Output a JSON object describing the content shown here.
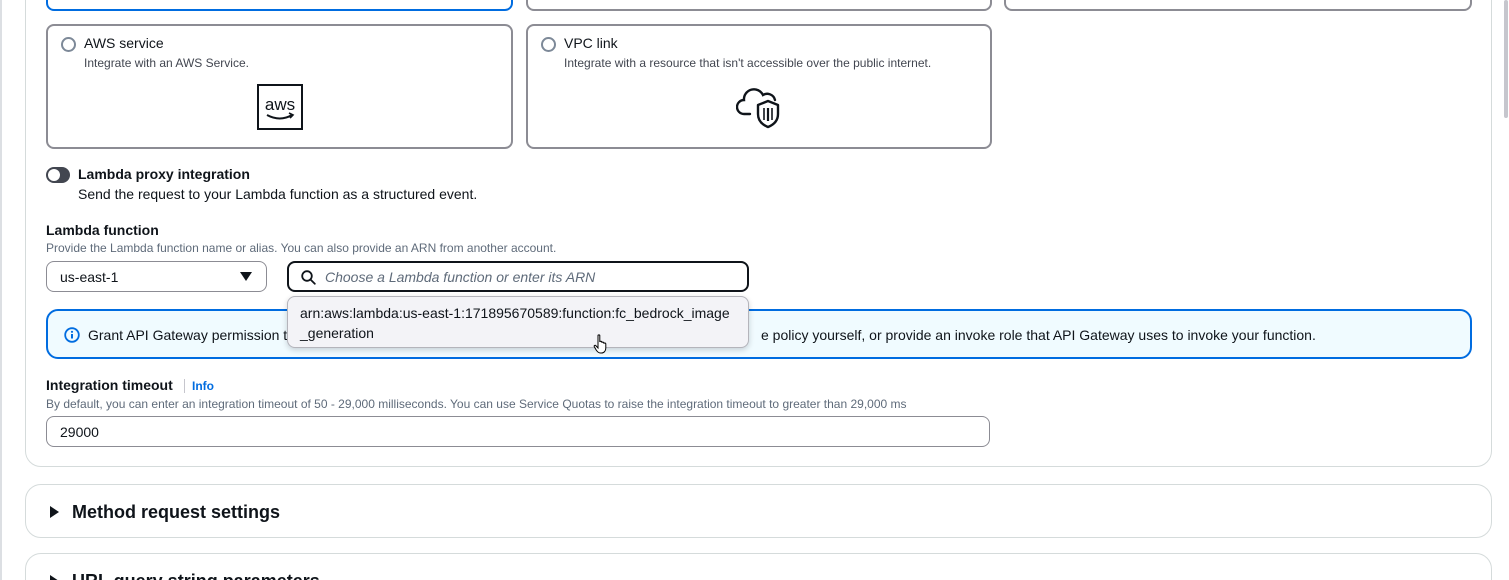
{
  "integration_types": {
    "aws_service": {
      "title": "AWS service",
      "description": "Integrate with an AWS Service.",
      "icon": "aws-logo-icon"
    },
    "vpc_link": {
      "title": "VPC link",
      "description": "Integrate with a resource that isn't accessible over the public internet.",
      "icon": "cloud-shield-icon"
    }
  },
  "proxy": {
    "label": "Lambda proxy integration",
    "description": "Send the request to your Lambda function as a structured event.",
    "enabled": false
  },
  "lambda_function": {
    "label": "Lambda function",
    "description": "Provide the Lambda function name or alias. You can also provide an ARN from another account.",
    "region": "us-east-1",
    "search_placeholder": "Choose a Lambda function or enter its ARN",
    "dropdown_option": "arn:aws:lambda:us-east-1:171895670589:function:fc_bedrock_image_generation"
  },
  "alert": {
    "text_start": "Grant API Gateway permission t",
    "text_end": "e policy yourself, or provide an invoke role that API Gateway uses to invoke your function."
  },
  "timeout": {
    "label": "Integration timeout",
    "info_link": "Info",
    "description": "By default, you can enter an integration timeout of 50 - 29,000 milliseconds. You can use Service Quotas to raise the integration timeout to greater than 29,000 ms",
    "value": "29000"
  },
  "sections": {
    "method_request": "Method request settings",
    "url_query": "URL query string parameters"
  },
  "colors": {
    "accent": "#006ce0",
    "alert_bg": "#f0fbff",
    "text": "#0f141a"
  }
}
